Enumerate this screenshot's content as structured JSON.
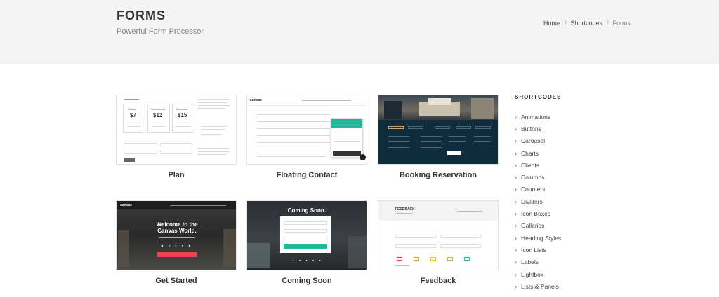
{
  "header": {
    "title": "FORMS",
    "subtitle": "Powerful Form Processor",
    "breadcrumb": [
      "Home",
      "Shortcodes",
      "Forms"
    ]
  },
  "cards": [
    {
      "title": "Plan"
    },
    {
      "title": "Floating Contact"
    },
    {
      "title": "Booking Reservation"
    },
    {
      "title": "Get Started"
    },
    {
      "title": "Coming Soon"
    },
    {
      "title": "Feedback"
    }
  ],
  "thumbs": {
    "plan": {
      "plans": [
        {
          "name": "Starter",
          "price": "7"
        },
        {
          "name": "Professional",
          "price": "12"
        },
        {
          "name": "Business",
          "price": "15"
        }
      ]
    },
    "floating": {
      "brand": "canvas"
    },
    "getstarted": {
      "brand": "canvas",
      "headline1": "Welcome to the",
      "headline2": "Canvas World."
    },
    "comingsoon": {
      "headline": "Coming Soon.."
    },
    "feedback": {
      "title": "FEEDBACK"
    }
  },
  "sidebar": {
    "heading": "SHORTCODES",
    "items": [
      "Animations",
      "Buttons",
      "Carousel",
      "Charts",
      "Clients",
      "Columns",
      "Counters",
      "Dividers",
      "Icon Boxes",
      "Galleries",
      "Heading Styles",
      "Icon Lists",
      "Labels",
      "Lightbox",
      "Lists & Panels"
    ]
  },
  "colors": {
    "accent_teal": "#1abc9c",
    "dark_navy": "#0f2d3d",
    "cta_red": "#e8414f",
    "page_band": "#f4f4f4"
  },
  "icons": {
    "sidebar_item": "chevron-right-icon"
  }
}
